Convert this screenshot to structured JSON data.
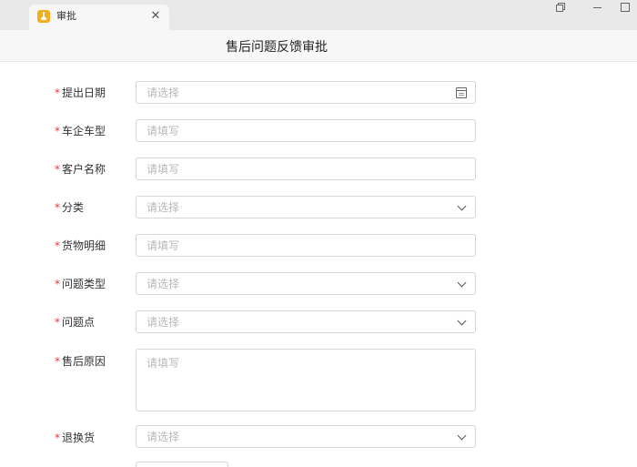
{
  "window": {
    "tab_title": "审批",
    "close_glyph": "✕"
  },
  "header": {
    "title": "售后问题反馈审批"
  },
  "form": {
    "required_mark": "*",
    "fields": [
      {
        "label": "提出日期",
        "placeholder": "请选择",
        "kind": "date"
      },
      {
        "label": "车企车型",
        "placeholder": "请填写",
        "kind": "text"
      },
      {
        "label": "客户名称",
        "placeholder": "请填写",
        "kind": "text"
      },
      {
        "label": "分类",
        "placeholder": "请选择",
        "kind": "select"
      },
      {
        "label": "货物明细",
        "placeholder": "请填写",
        "kind": "text"
      },
      {
        "label": "问题类型",
        "placeholder": "请选择",
        "kind": "select"
      },
      {
        "label": "问题点",
        "placeholder": "请选择",
        "kind": "select"
      },
      {
        "label": "售后原因",
        "placeholder": "请填写",
        "kind": "textarea"
      },
      {
        "label": "退换货",
        "placeholder": "请选择",
        "kind": "select"
      }
    ]
  },
  "icons": {
    "tab_icon": "app-logo-icon",
    "date_icon": "calendar-icon",
    "select_icon": "chevron-down-icon"
  },
  "colors": {
    "required": "#e4393c",
    "app_icon": "#f2b01e"
  }
}
